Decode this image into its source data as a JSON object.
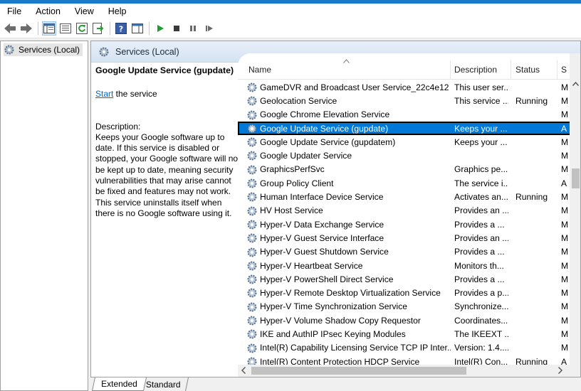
{
  "menu": [
    "File",
    "Action",
    "View",
    "Help"
  ],
  "tree": {
    "label": "Services (Local)"
  },
  "header": {
    "title": "Services (Local)"
  },
  "detail": {
    "service_title": "Google Update Service (gupdate)",
    "action_link": "Start",
    "action_rest": " the service",
    "desc_label": "Description:",
    "desc_text": "Keeps your Google software up to date. If this service is disabled or stopped, your Google software will not be kept up to date, meaning security vulnerabilities that may arise cannot be fixed and features may not work. This service uninstalls itself when there is no Google software using it."
  },
  "columns": {
    "name": "Name",
    "description": "Description",
    "status": "Status",
    "startup": "S"
  },
  "services": [
    {
      "name": "GameDVR and Broadcast User Service_22c4e12",
      "description": "This user ser...",
      "status": "",
      "startup": "M"
    },
    {
      "name": "Geolocation Service",
      "description": "This service ...",
      "status": "Running",
      "startup": "M"
    },
    {
      "name": "Google Chrome Elevation Service",
      "description": "",
      "status": "",
      "startup": "M"
    },
    {
      "name": "Google Update Service (gupdate)",
      "description": "Keeps your ...",
      "status": "",
      "startup": "A"
    },
    {
      "name": "Google Update Service (gupdatem)",
      "description": "Keeps your ...",
      "status": "",
      "startup": "M"
    },
    {
      "name": "Google Updater Service",
      "description": "",
      "status": "",
      "startup": "M"
    },
    {
      "name": "GraphicsPerfSvc",
      "description": "Graphics pe...",
      "status": "",
      "startup": "M"
    },
    {
      "name": "Group Policy Client",
      "description": "The service i...",
      "status": "",
      "startup": "A"
    },
    {
      "name": "Human Interface Device Service",
      "description": "Activates an...",
      "status": "Running",
      "startup": "M"
    },
    {
      "name": "HV Host Service",
      "description": "Provides an ...",
      "status": "",
      "startup": "M"
    },
    {
      "name": "Hyper-V Data Exchange Service",
      "description": "Provides a ...",
      "status": "",
      "startup": "M"
    },
    {
      "name": "Hyper-V Guest Service Interface",
      "description": "Provides an ...",
      "status": "",
      "startup": "M"
    },
    {
      "name": "Hyper-V Guest Shutdown Service",
      "description": "Provides a ...",
      "status": "",
      "startup": "M"
    },
    {
      "name": "Hyper-V Heartbeat Service",
      "description": "Monitors th...",
      "status": "",
      "startup": "M"
    },
    {
      "name": "Hyper-V PowerShell Direct Service",
      "description": "Provides a ...",
      "status": "",
      "startup": "M"
    },
    {
      "name": "Hyper-V Remote Desktop Virtualization Service",
      "description": "Provides a p...",
      "status": "",
      "startup": "M"
    },
    {
      "name": "Hyper-V Time Synchronization Service",
      "description": "Synchronize...",
      "status": "",
      "startup": "M"
    },
    {
      "name": "Hyper-V Volume Shadow Copy Requestor",
      "description": "Coordinates...",
      "status": "",
      "startup": "M"
    },
    {
      "name": "IKE and AuthIP IPsec Keying Modules",
      "description": "The IKEEXT ...",
      "status": "",
      "startup": "M"
    },
    {
      "name": "Intel(R) Capability Licensing Service TCP IP Inter...",
      "description": "Version: 1.4....",
      "status": "",
      "startup": "M"
    },
    {
      "name": "Intel(R) Content Protection HDCP Service",
      "description": "Intel(R) Con...",
      "status": "Running",
      "startup": "A"
    }
  ],
  "selected_index": 3,
  "tabs": [
    "Extended",
    "Standard"
  ],
  "active_tab": "Extended"
}
